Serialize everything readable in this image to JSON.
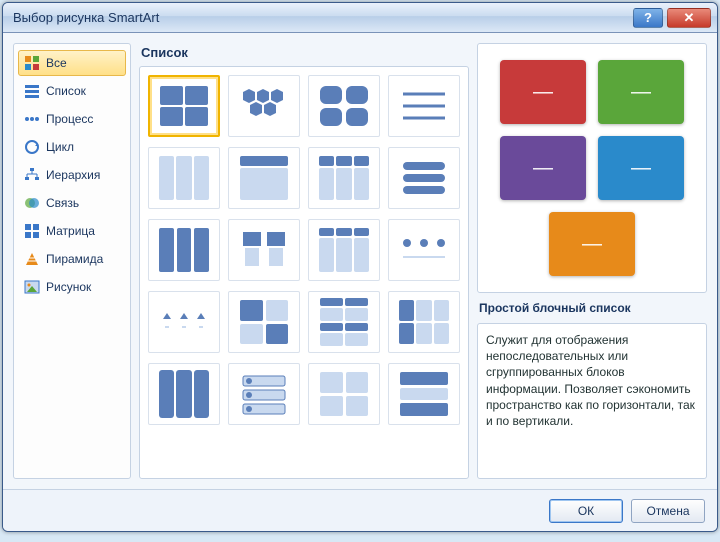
{
  "window": {
    "title": "Выбор рисунка SmartArt"
  },
  "sidebar": {
    "items": [
      {
        "label": "Все",
        "icon": "all"
      },
      {
        "label": "Список",
        "icon": "list"
      },
      {
        "label": "Процесс",
        "icon": "process"
      },
      {
        "label": "Цикл",
        "icon": "cycle"
      },
      {
        "label": "Иерархия",
        "icon": "hierarchy"
      },
      {
        "label": "Связь",
        "icon": "relation"
      },
      {
        "label": "Матрица",
        "icon": "matrix"
      },
      {
        "label": "Пирамида",
        "icon": "pyramid"
      },
      {
        "label": "Рисунок",
        "icon": "picture"
      }
    ],
    "selected_index": 0
  },
  "gallery": {
    "heading": "Список"
  },
  "preview": {
    "title": "Простой блочный список",
    "description": "Служит для отображения непоследовательных или сгруппированных блоков информации. Позволяет сэкономить пространство как по горизонтали, так и по вертикали.",
    "blocks": [
      {
        "color": "#c73a3a"
      },
      {
        "color": "#5aa63a"
      },
      {
        "color": "#6a4a9a"
      },
      {
        "color": "#2a8acb"
      },
      {
        "color": "#e78a1a"
      }
    ]
  },
  "footer": {
    "ok": "ОК",
    "cancel": "Отмена"
  }
}
